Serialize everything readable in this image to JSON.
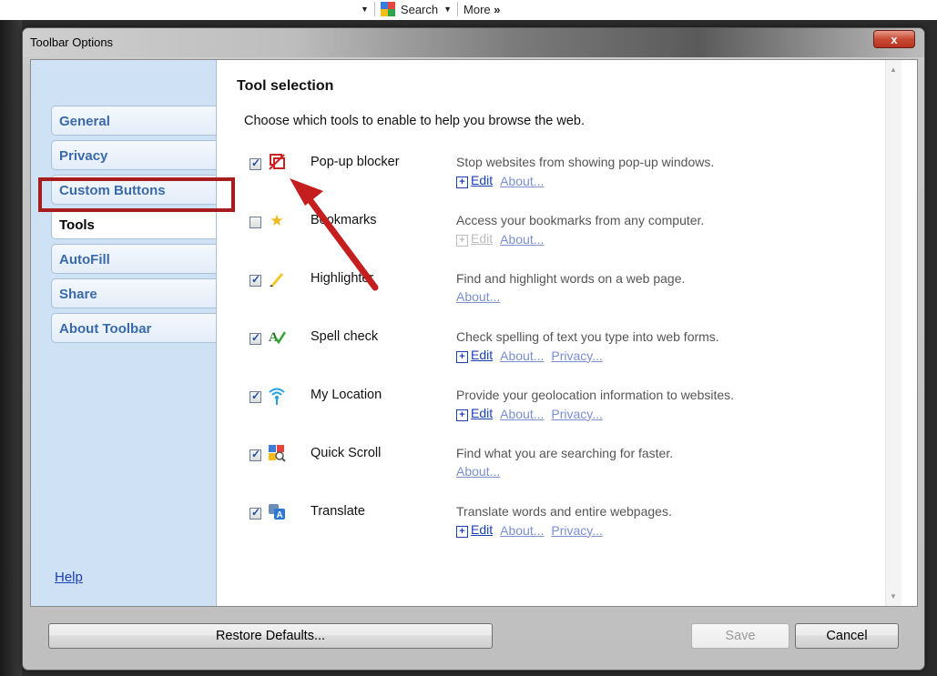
{
  "browser_toolbar": {
    "search_label": "Search",
    "more_label": "More",
    "more_glyph": "»"
  },
  "window": {
    "title": "Toolbar Options",
    "close_glyph": "x"
  },
  "sidebar": {
    "items": [
      {
        "label": "General",
        "active": false
      },
      {
        "label": "Privacy",
        "active": false
      },
      {
        "label": "Custom Buttons",
        "active": false
      },
      {
        "label": "Tools",
        "active": true
      },
      {
        "label": "AutoFill",
        "active": false
      },
      {
        "label": "Share",
        "active": false
      },
      {
        "label": "About Toolbar",
        "active": false
      }
    ],
    "help_label": "Help"
  },
  "content": {
    "title": "Tool selection",
    "description": "Choose which tools to enable to help you browse the web.",
    "tools": [
      {
        "name": "Pop-up blocker",
        "checked": true,
        "icon": "popup-blocker-icon",
        "description": "Stop websites from showing pop-up windows.",
        "edit": "Edit",
        "about": "About...",
        "privacy": null,
        "edit_enabled": true
      },
      {
        "name": "Bookmarks",
        "checked": false,
        "icon": "star-icon",
        "description": "Access your bookmarks from any computer.",
        "edit": "Edit",
        "about": "About...",
        "privacy": null,
        "edit_enabled": false
      },
      {
        "name": "Highlighter",
        "checked": true,
        "icon": "highlighter-icon",
        "description": "Find and highlight words on a web page.",
        "edit": null,
        "about": "About...",
        "privacy": null,
        "edit_enabled": false
      },
      {
        "name": "Spell check",
        "checked": true,
        "icon": "spellcheck-icon",
        "description": "Check spelling of text you type into web forms.",
        "edit": "Edit",
        "about": "About...",
        "privacy": "Privacy...",
        "edit_enabled": true
      },
      {
        "name": "My Location",
        "checked": true,
        "icon": "location-icon",
        "description": "Provide your geolocation information to websites.",
        "edit": "Edit",
        "about": "About...",
        "privacy": "Privacy...",
        "edit_enabled": true
      },
      {
        "name": "Quick Scroll",
        "checked": true,
        "icon": "quick-scroll-icon",
        "description": "Find what you are searching for faster.",
        "edit": null,
        "about": "About...",
        "privacy": null,
        "edit_enabled": false
      },
      {
        "name": "Translate",
        "checked": true,
        "icon": "translate-icon",
        "description": "Translate words and entire webpages.",
        "edit": "Edit",
        "about": "About...",
        "privacy": "Privacy...",
        "edit_enabled": true
      }
    ]
  },
  "footer": {
    "restore_label": "Restore Defaults...",
    "save_label": "Save",
    "cancel_label": "Cancel"
  },
  "annotation": {
    "highlight_color": "#a71c1c",
    "arrow_color": "#c41e1e"
  }
}
